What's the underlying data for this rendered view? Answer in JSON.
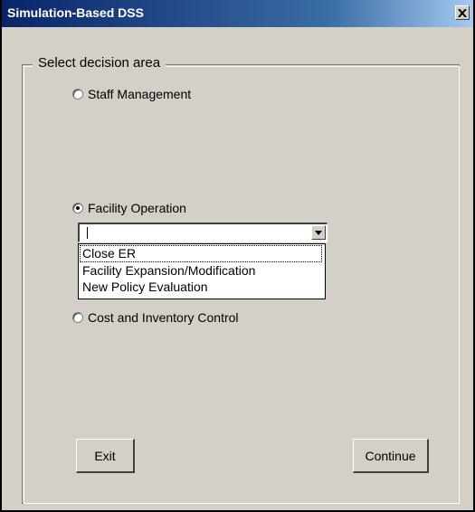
{
  "window": {
    "title": "Simulation-Based DSS",
    "close_icon": "close-icon"
  },
  "group": {
    "legend": "Select decision area"
  },
  "radios": [
    {
      "label": "Staff Management",
      "checked": false
    },
    {
      "label": "Facility Operation",
      "checked": true
    },
    {
      "label": "Cost and Inventory Control",
      "checked": false
    }
  ],
  "combo": {
    "value": "",
    "options": [
      "Close ER",
      "Facility Expansion/Modification",
      "New Policy Evaluation"
    ]
  },
  "buttons": {
    "exit": "Exit",
    "continue": "Continue"
  }
}
